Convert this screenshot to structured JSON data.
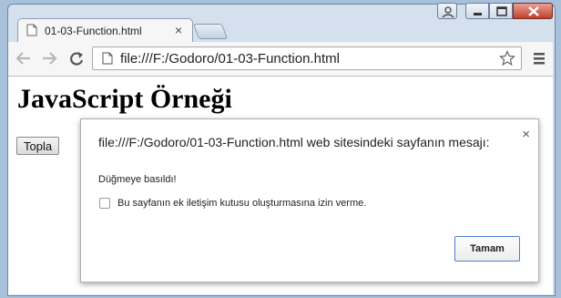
{
  "browser": {
    "tab_title": "01-03-Function.html",
    "tab_close": "×",
    "address": "file:///F:/Godoro/01-03-Function.html"
  },
  "page": {
    "heading": "JavaScript Örneği",
    "topla_button": "Topla"
  },
  "dialog": {
    "title": "file:///F:/Godoro/01-03-Function.html web sitesindeki sayfanın mesajı:",
    "close": "×",
    "message": "Düğmeye basıldı!",
    "checkbox_label": "Bu sayfanın ek iletişim kutusu oluşturmasına izin verme.",
    "ok_label": "Tamam",
    "checkbox_checked": false
  },
  "colors": {
    "accent": "#4b7fd4",
    "close_button": "#c0402d"
  }
}
